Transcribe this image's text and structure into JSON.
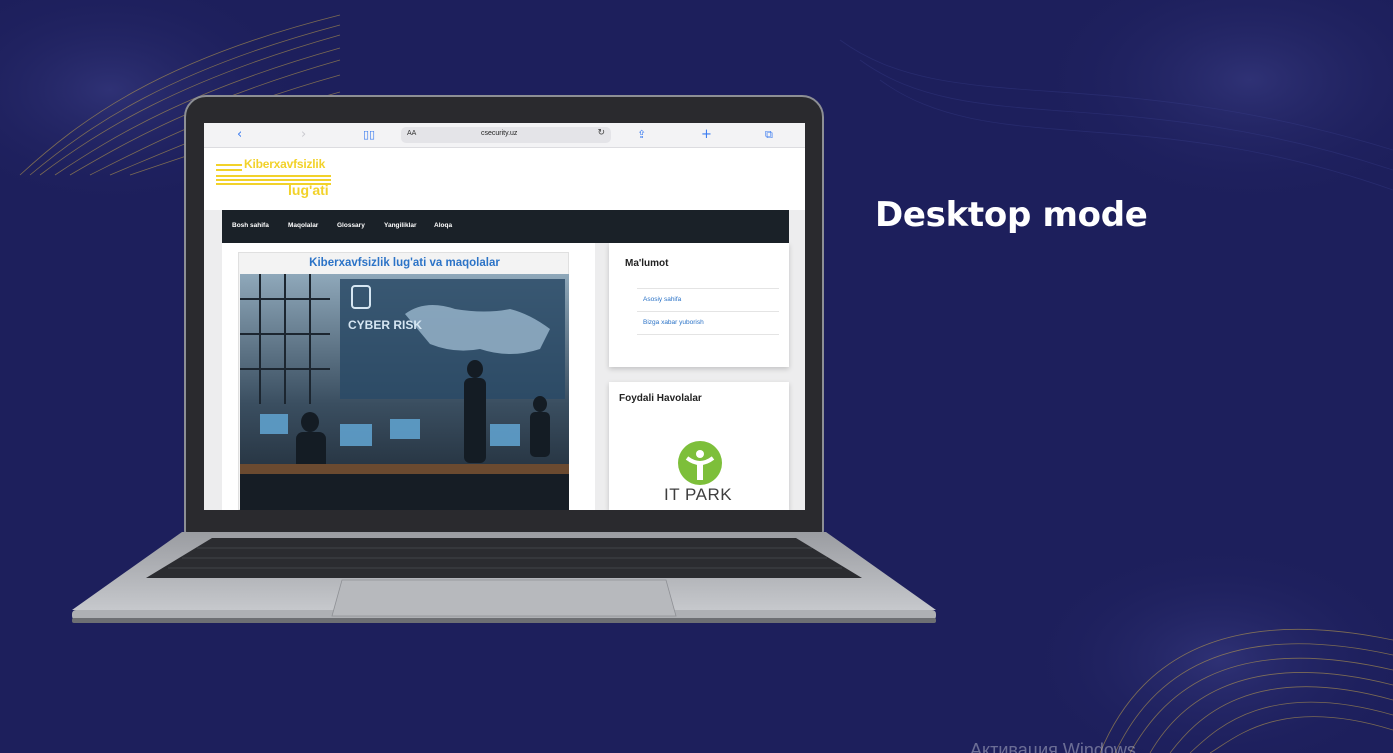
{
  "headline": "Desktop mode",
  "watermark": "Активация Windows",
  "browser": {
    "url": "csecurity.uz",
    "text_size_label": "AA",
    "icons": [
      "chevron-left-icon",
      "chevron-right-icon",
      "book-icon",
      "lock-icon",
      "reload-icon",
      "share-icon",
      "plus-icon",
      "tabs-icon"
    ]
  },
  "site": {
    "logo_line1": "Kiberxavfsizlik",
    "logo_line2": "lug'ati",
    "nav": [
      "Bosh sahifa",
      "Maqolalar",
      "Glossary",
      "Yangiliklar",
      "Aloqa"
    ],
    "article_title": "Kiberxavfsizlik lug'ati va maqolalar",
    "image_text": "CYBER RISK",
    "sidebar1": {
      "title": "Ma'lumot",
      "links": [
        "Asosiy sahifa",
        "Bizga xabar yuborish"
      ]
    },
    "sidebar2": {
      "title": "Foydali Havolalar",
      "logo_text": "IT PARK"
    }
  },
  "colors": {
    "background": "#1d1f5c",
    "logo_yellow": "#f2d22a",
    "link_blue": "#2b73c7",
    "navbar": "#1a2128",
    "itpark_green": "#7dbf3a"
  }
}
